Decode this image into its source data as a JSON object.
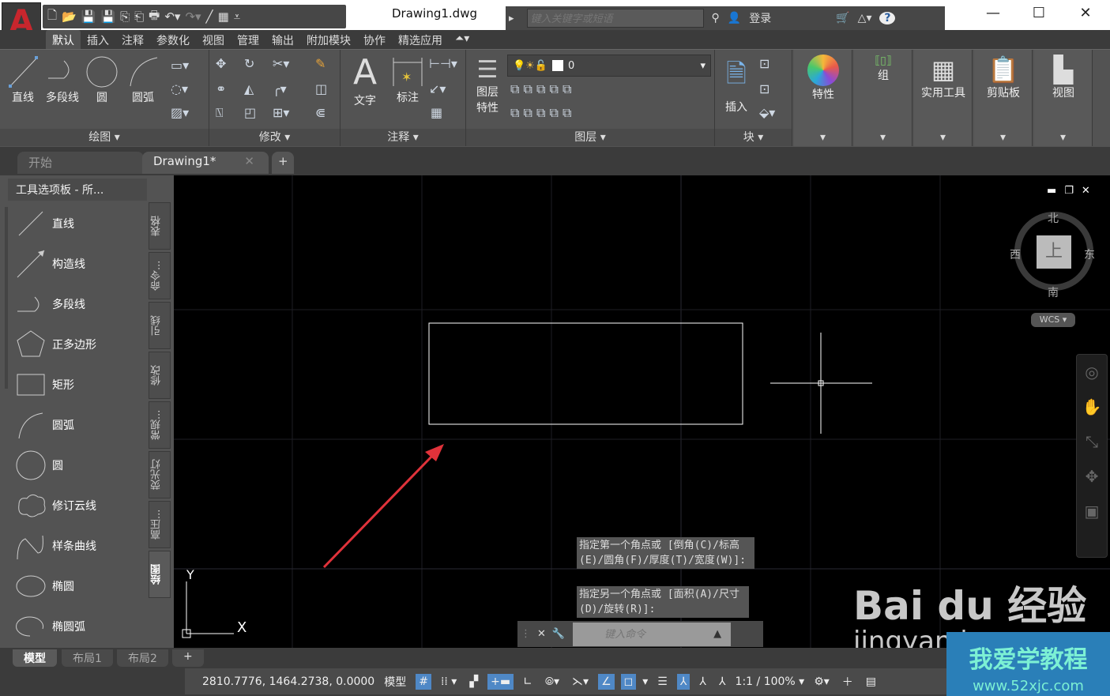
{
  "app": {
    "logo": "A",
    "document_title": "Drawing1.dwg"
  },
  "search": {
    "placeholder": "键入关键字或短语",
    "login": "登录"
  },
  "window": {
    "minimize": "—",
    "maximize": "☐",
    "close": "✕"
  },
  "ribbon_tabs": [
    "默认",
    "插入",
    "注释",
    "参数化",
    "视图",
    "管理",
    "输出",
    "附加模块",
    "协作",
    "精选应用"
  ],
  "ribbon": {
    "draw": {
      "label": "绘图",
      "tools": [
        "直线",
        "多段线",
        "圆",
        "圆弧"
      ]
    },
    "modify": {
      "label": "修改"
    },
    "annotate": {
      "label": "注释",
      "tools": [
        "文字",
        "标注"
      ]
    },
    "layers": {
      "label": "图层",
      "props": "图层\n特性",
      "current_layer": "0"
    },
    "block": {
      "label": "块",
      "insert": "插入"
    },
    "properties": "特性",
    "groups": "组",
    "utilities": "实用工具",
    "clipboard": "剪贴板",
    "view": "视图"
  },
  "file_tabs": {
    "start": "开始",
    "drawing": "Drawing1*",
    "close": "✕",
    "new": "+"
  },
  "palette": {
    "title": "工具选项板 - 所...",
    "items": [
      "直线",
      "构造线",
      "多段线",
      "正多边形",
      "矩形",
      "圆弧",
      "圆",
      "修订云线",
      "样条曲线",
      "椭圆",
      "椭圆弧"
    ],
    "side_tabs": [
      "表格",
      "命令...",
      "引线",
      "修改",
      "常规...",
      "荧光灯",
      "高压...",
      "绘图"
    ]
  },
  "viewcube": {
    "north": "北",
    "south": "南",
    "east": "东",
    "west": "西",
    "top": "上",
    "wcs": "WCS"
  },
  "ucs": {
    "x": "X",
    "y": "Y"
  },
  "command": {
    "prompt1": "指定第一个角点或 [倒角(C)/标高(E)/圆角(F)/厚度(T)/宽度(W)]:",
    "prompt2": "指定另一个角点或 [面积(A)/尺寸(D)/旋转(R)]:",
    "placeholder": "键入命令"
  },
  "layout_tabs": [
    "模型",
    "布局1",
    "布局2"
  ],
  "status": {
    "coords": "2810.7776, 1464.2738, 0.0000",
    "model": "模型",
    "scale": "1:1 / 100%"
  },
  "watermark": {
    "baidu": "Bai du 经验",
    "url": "jingyan.b",
    "site": "我爱学教程",
    "site_url": "www.52xjc.com"
  },
  "colors": {
    "canvas": "#000000",
    "ribbon": "#535353",
    "accent": "#4f88c6",
    "arrow": "#e0323a"
  }
}
